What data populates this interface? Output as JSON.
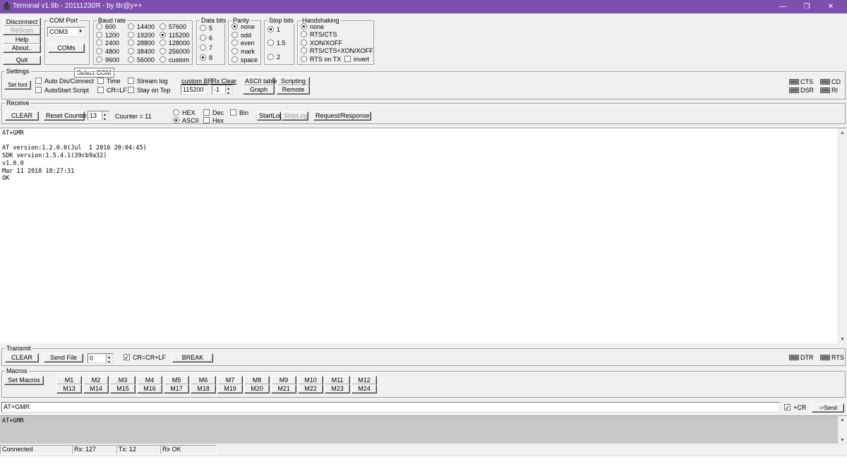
{
  "window": {
    "title": "Terminal v1.9b - 20111230Я - by Br@y++",
    "minimize": "—",
    "restore": "❐",
    "close": "✕",
    "title_color": "#7d4fae"
  },
  "left_buttons": {
    "disconnect": "Disconnect",
    "rescan": "ReScan",
    "help": "Help",
    "about": "About..",
    "quit": "Quit"
  },
  "com_port": {
    "legend": "COM Port",
    "value": "COM3",
    "coms_button": "COMs",
    "tooltip": "Select COM"
  },
  "baud_rate": {
    "legend": "Baud rate",
    "options": [
      "600",
      "1200",
      "2400",
      "4800",
      "9600",
      "14400",
      "19200",
      "28800",
      "38400",
      "56000",
      "57600",
      "115200",
      "128000",
      "256000",
      "custom"
    ],
    "selected": "115200"
  },
  "data_bits": {
    "legend": "Data bits",
    "options": [
      "5",
      "6",
      "7",
      "8"
    ],
    "selected": "8"
  },
  "parity": {
    "legend": "Parity",
    "options": [
      "none",
      "odd",
      "even",
      "mark",
      "space"
    ],
    "selected": "none"
  },
  "stop_bits": {
    "legend": "Stop bits",
    "options": [
      "1",
      "1.5",
      "2"
    ],
    "selected": "1"
  },
  "handshaking": {
    "legend": "Handshaking",
    "options": [
      "none",
      "RTS/CTS",
      "XON/XOFF",
      "RTS/CTS+XON/XOFF",
      "RTS on TX"
    ],
    "invert_label": "invert",
    "selected": "none"
  },
  "settings": {
    "legend": "Settings",
    "set_font": "Set font",
    "auto_dis_connect": "Auto Dis/Connect",
    "autostart_script": "AutoStart Script",
    "time": "Time",
    "cr_lf": "CR=LF",
    "stream_log": "Stream log",
    "stay_on_top": "Stay on Top",
    "custom_br_label": "custom BR",
    "custom_br_value": "115200",
    "rx_clear_label": "Rx Clear",
    "rx_clear_value": "-1",
    "ascii_table": "ASCII table",
    "graph": "Graph",
    "scripting": "Scripting",
    "remote": "Remote"
  },
  "signals": {
    "cts": "CTS",
    "cd": "CD",
    "dsr": "DSR",
    "ri": "RI",
    "dtr": "DTR",
    "rts": "RTS"
  },
  "receive": {
    "legend": "Receive",
    "clear": "CLEAR",
    "reset_counter": "Reset Counter",
    "counter_spin": "13",
    "counter_text": "Counter = 11",
    "hex": "HEX",
    "ascii": "ASCII",
    "dec": "Dec",
    "hex_chk": "Hex",
    "bin": "Bin",
    "startlog": "StartLog",
    "stoplog": "StopLog",
    "request_response": "Request/Response",
    "selected_mode": "ASCII",
    "log": "AT+GMR\n\nAT version:1.2.0.0(Jul  1 2016 20:04:45)\nSDK version:1.5.4.1(39cb9a32)\nv1.0.0\nMar 11 2018 18:27:31\nOK"
  },
  "transmit": {
    "legend": "Transmit",
    "clear": "CLEAR",
    "send_file": "Send File",
    "spin_value": "0",
    "cr_crlf": "CR=CR+LF",
    "break": "BREAK"
  },
  "macros": {
    "legend": "Macros",
    "set_macros": "Set Macros",
    "row1": [
      "M1",
      "M2",
      "M3",
      "M4",
      "M5",
      "M6",
      "M7",
      "M8",
      "M9",
      "M10",
      "M11",
      "M12"
    ],
    "row2": [
      "M13",
      "M14",
      "M15",
      "M16",
      "M17",
      "M18",
      "M19",
      "M20",
      "M21",
      "M22",
      "M23",
      "M24"
    ]
  },
  "input": {
    "value": "AT+GMR",
    "plus_cr": "+CR",
    "send": "->Send"
  },
  "sent_log": "AT+GMR",
  "status": {
    "connected": "Connected",
    "rx": "Rx: 127",
    "tx": "Tx: 12",
    "rx_ok": "Rx OK"
  }
}
